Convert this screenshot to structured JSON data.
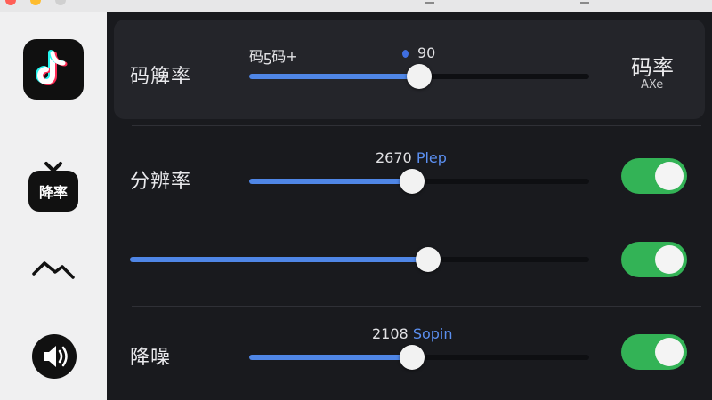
{
  "icons": {
    "app": "tiktok-icon",
    "tv": "tv-icon",
    "wave": "wave-icon",
    "speaker": "speaker-icon"
  },
  "colors": {
    "accent_blue": "#4f86e6",
    "toggle_on": "#33b356",
    "background": "#191a1e"
  },
  "sidebar": {
    "tv_label": "降率"
  },
  "bitrate": {
    "label": "码簰率",
    "value_prefix": "码ƽ码+",
    "value": "90",
    "right_label": "码率",
    "right_sub": "AXe",
    "level": 0.5
  },
  "resolution": {
    "label": "分辨率",
    "value_number": "2670",
    "value_unit": "Plep",
    "level": 0.48,
    "toggle_on": true
  },
  "unnamed": {
    "level": 0.65,
    "toggle_on": true
  },
  "noise": {
    "label": "降噪",
    "value_number": "2108",
    "value_unit": "Sopin",
    "level": 0.48,
    "toggle_on": true
  }
}
